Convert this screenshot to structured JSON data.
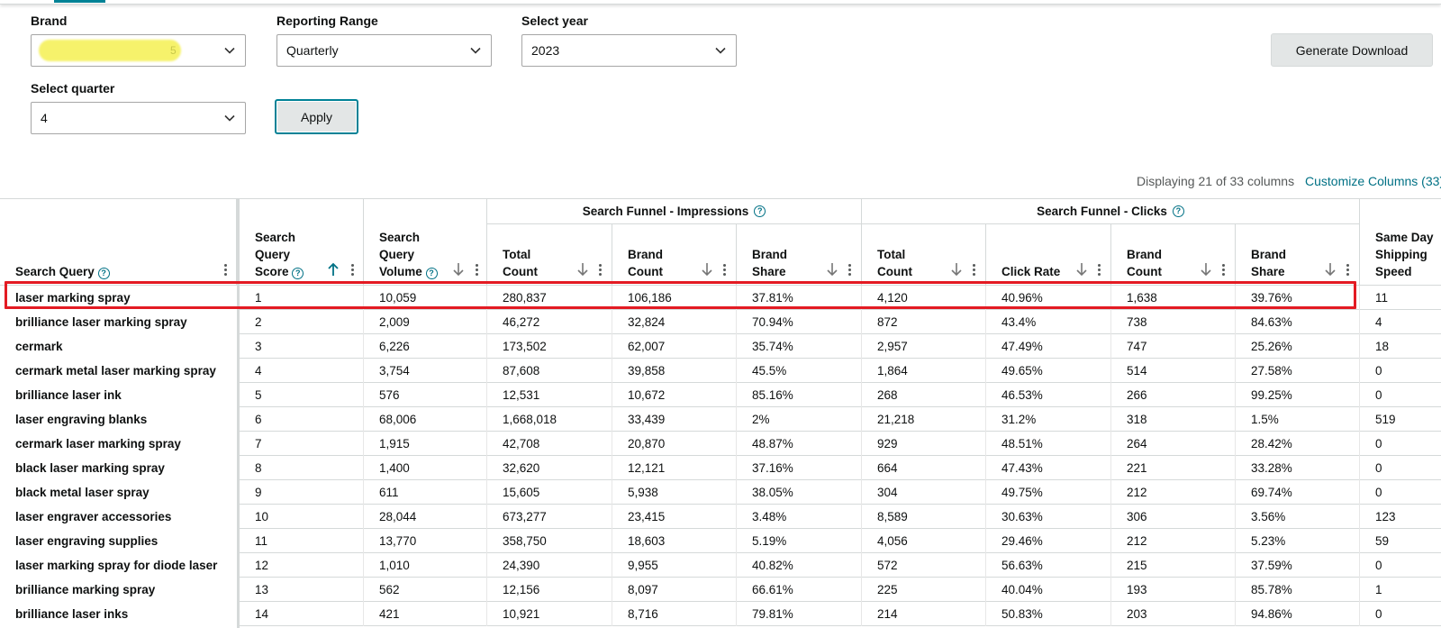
{
  "filters": {
    "brand": {
      "label": "Brand",
      "value": "5"
    },
    "range": {
      "label": "Reporting Range",
      "value": "Quarterly"
    },
    "year": {
      "label": "Select year",
      "value": "2023"
    },
    "quarter": {
      "label": "Select quarter",
      "value": "4"
    }
  },
  "buttons": {
    "generate": "Generate Download",
    "apply": "Apply"
  },
  "table_meta": {
    "displaying": "Displaying 21 of 33 columns",
    "customize": "Customize Columns (33)"
  },
  "groups": {
    "impressions": "Search Funnel - Impressions",
    "clicks": "Search Funnel - Clicks"
  },
  "headers": {
    "query": "Search Query",
    "score": "Search Query Score",
    "volume": "Search Query Volume",
    "imp_total": "Total Count",
    "imp_brand": "Brand Count",
    "imp_share": "Brand Share",
    "clk_total": "Total Count",
    "clk_rate": "Click Rate",
    "clk_brand": "Brand Count",
    "clk_share": "Brand Share",
    "sameday": "Same Day Shipping Speed"
  },
  "rows": [
    [
      "laser marking spray",
      "1",
      "10,059",
      "280,837",
      "106,186",
      "37.81%",
      "4,120",
      "40.96%",
      "1,638",
      "39.76%",
      "11"
    ],
    [
      "brilliance laser marking spray",
      "2",
      "2,009",
      "46,272",
      "32,824",
      "70.94%",
      "872",
      "43.4%",
      "738",
      "84.63%",
      "4"
    ],
    [
      "cermark",
      "3",
      "6,226",
      "173,502",
      "62,007",
      "35.74%",
      "2,957",
      "47.49%",
      "747",
      "25.26%",
      "18"
    ],
    [
      "cermark metal laser marking spray",
      "4",
      "3,754",
      "87,608",
      "39,858",
      "45.5%",
      "1,864",
      "49.65%",
      "514",
      "27.58%",
      "0"
    ],
    [
      "brilliance laser ink",
      "5",
      "576",
      "12,531",
      "10,672",
      "85.16%",
      "268",
      "46.53%",
      "266",
      "99.25%",
      "0"
    ],
    [
      "laser engraving blanks",
      "6",
      "68,006",
      "1,668,018",
      "33,439",
      "2%",
      "21,218",
      "31.2%",
      "318",
      "1.5%",
      "519"
    ],
    [
      "cermark laser marking spray",
      "7",
      "1,915",
      "42,708",
      "20,870",
      "48.87%",
      "929",
      "48.51%",
      "264",
      "28.42%",
      "0"
    ],
    [
      "black laser marking spray",
      "8",
      "1,400",
      "32,620",
      "12,121",
      "37.16%",
      "664",
      "47.43%",
      "221",
      "33.28%",
      "0"
    ],
    [
      "black metal laser spray",
      "9",
      "611",
      "15,605",
      "5,938",
      "38.05%",
      "304",
      "49.75%",
      "212",
      "69.74%",
      "0"
    ],
    [
      "laser engraver accessories",
      "10",
      "28,044",
      "673,277",
      "23,415",
      "3.48%",
      "8,589",
      "30.63%",
      "306",
      "3.56%",
      "123"
    ],
    [
      "laser engraving supplies",
      "11",
      "13,770",
      "358,750",
      "18,603",
      "5.19%",
      "4,056",
      "29.46%",
      "212",
      "5.23%",
      "59"
    ],
    [
      "laser marking spray for diode laser",
      "12",
      "1,010",
      "24,390",
      "9,955",
      "40.82%",
      "572",
      "56.63%",
      "215",
      "37.59%",
      "0"
    ],
    [
      "brilliance marking spray",
      "13",
      "562",
      "12,156",
      "8,097",
      "66.61%",
      "225",
      "40.04%",
      "193",
      "85.78%",
      "1"
    ],
    [
      "brilliance laser inks",
      "14",
      "421",
      "10,921",
      "8,716",
      "79.81%",
      "214",
      "50.83%",
      "203",
      "94.86%",
      "0"
    ]
  ]
}
